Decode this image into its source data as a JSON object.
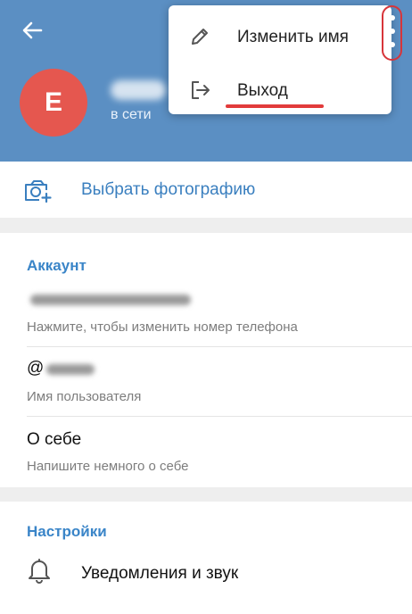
{
  "header": {
    "avatar_letter": "E",
    "status": "в сети",
    "back_icon": "arrow-left-icon",
    "more_icon": "more-vertical-icon"
  },
  "menu": {
    "items": [
      {
        "label": "Изменить имя",
        "icon": "pencil-icon"
      },
      {
        "label": "Выход",
        "icon": "logout-icon"
      }
    ]
  },
  "photo": {
    "label": "Выбрать фотографию",
    "icon": "camera-add-icon"
  },
  "account": {
    "title": "Аккаунт",
    "phone_hint": "Нажмите, чтобы изменить номер телефона",
    "username_prefix": "@",
    "username_hint": "Имя пользователя",
    "about_value": "О себе",
    "about_hint": "Напишите немного о себе"
  },
  "settings": {
    "title": "Настройки",
    "notifications_label": "Уведомления и звук",
    "notifications_icon": "bell-icon"
  },
  "colors": {
    "header_bg": "#5b8fc3",
    "accent": "#3a85c8",
    "avatar_bg": "#e5574f",
    "annotation_red": "#e23b3b"
  }
}
